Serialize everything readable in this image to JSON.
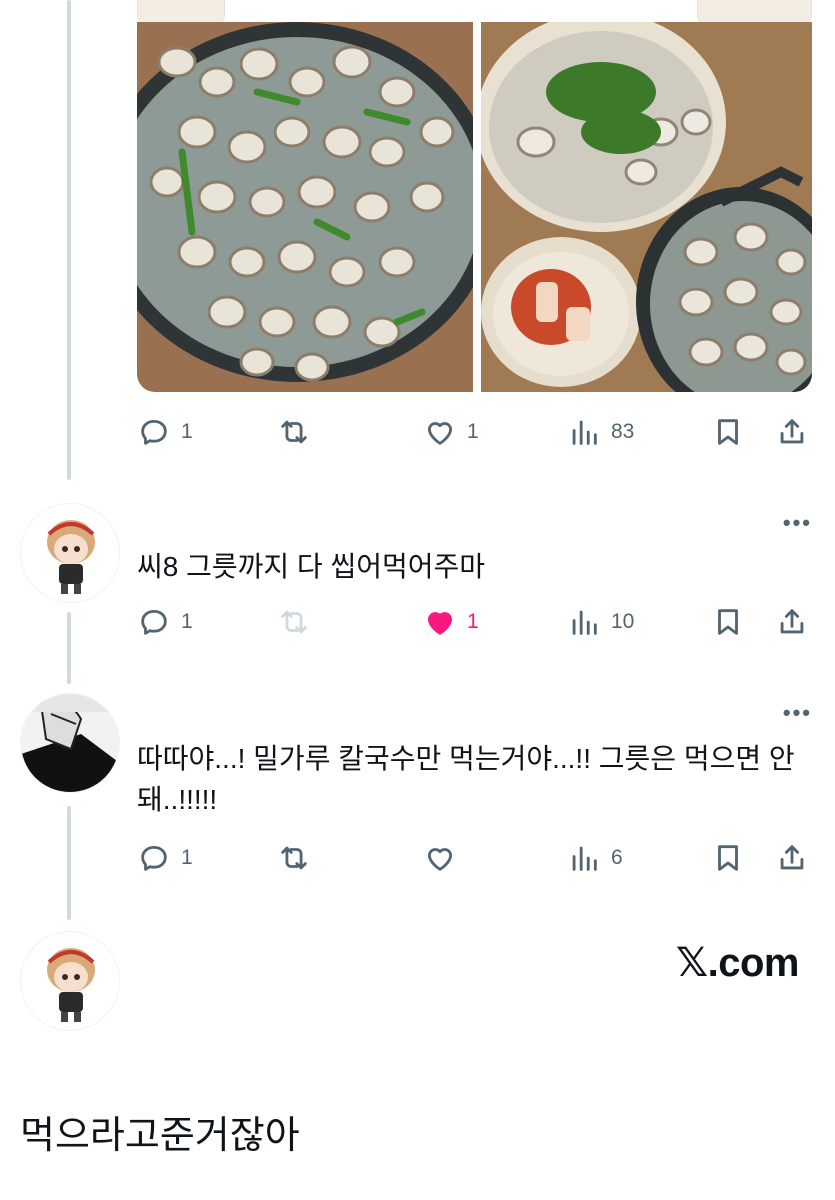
{
  "post": {
    "images": [
      {
        "name": "clam-pot-photo"
      },
      {
        "name": "kalguksu-kimchi-photo"
      }
    ],
    "actions": {
      "replies": "1",
      "reposts": "",
      "likes": "1",
      "views": "83"
    }
  },
  "replies": [
    {
      "avatar": "chibi-avatar",
      "text": "씨8 그릇까지 다 씹어먹어주마",
      "actions": {
        "replies": "1",
        "reposts": "",
        "likes": "1",
        "views": "10",
        "liked": true
      }
    },
    {
      "avatar": "manga-avatar",
      "text": "따따야...! 밀가루 칼국수만 먹는거야...!! 그릇은 먹으면 안돼..!!!!!",
      "actions": {
        "replies": "1",
        "reposts": "",
        "likes": "",
        "views": "6",
        "liked": false
      }
    }
  ],
  "watermark": "𝕏.com",
  "bottom_caption": "먹으라고준거잖아",
  "colors": {
    "like": "#f91880",
    "icon": "#536471",
    "thread": "#cfd9de"
  }
}
